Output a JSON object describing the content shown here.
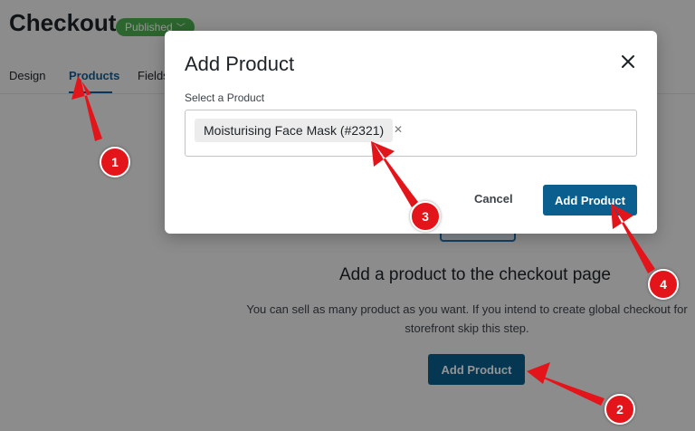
{
  "header": {
    "title": "Checkout",
    "status_badge": "Published"
  },
  "tabs": [
    {
      "label": "Design"
    },
    {
      "label": "Products"
    },
    {
      "label": "Fields"
    }
  ],
  "main": {
    "heading": "Add a product to the checkout page",
    "description_line1": "You can sell as many product as you want. If you intend to create global checkout for",
    "description_line2": "storefront skip this step.",
    "add_button": "Add Product"
  },
  "modal": {
    "title": "Add Product",
    "field_label": "Select a Product",
    "selected_product": "Moisturising Face Mask (#2321)",
    "cancel": "Cancel",
    "add_button": "Add Product"
  },
  "annotations": [
    "1",
    "2",
    "3",
    "4"
  ],
  "colors": {
    "primary": "#0a5f8f",
    "badge": "#4caf50",
    "marker": "#e3151b"
  }
}
